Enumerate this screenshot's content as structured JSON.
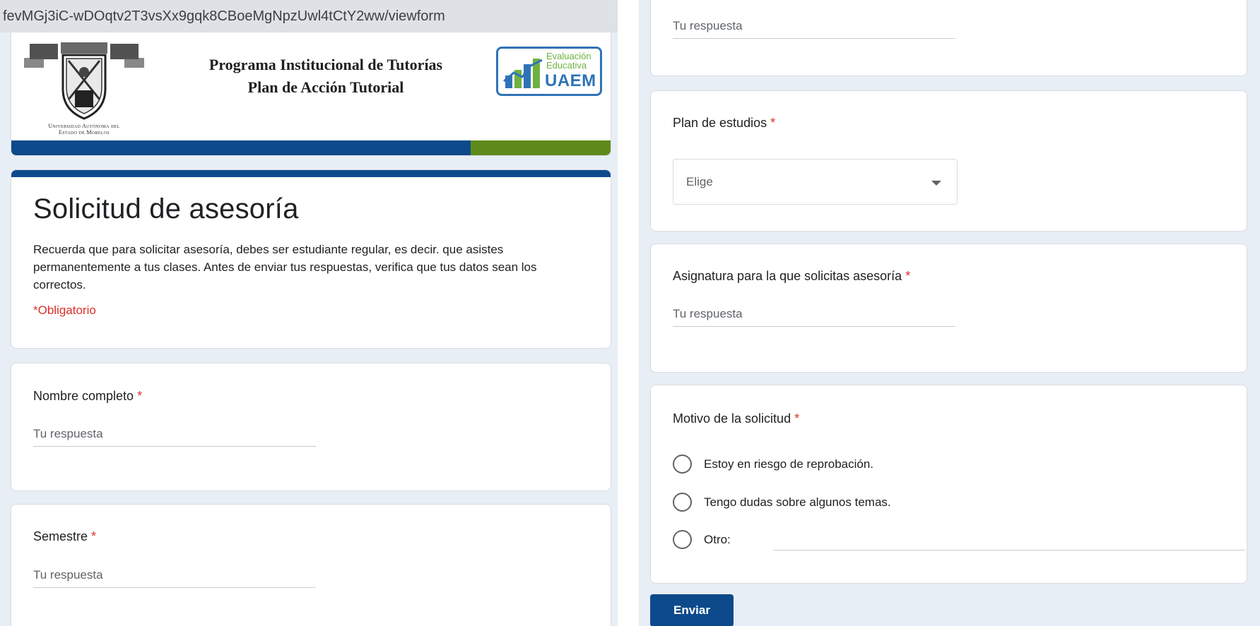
{
  "browser": {
    "url": "fevMGj3iC-wDOqtv2T3vsXx9gqk8CBoeMgNpzUwl4tCtY2ww/viewform"
  },
  "banner": {
    "crest_caption_line1": "Universidad Autónoma del",
    "crest_caption_line2": "Estado de Morelos",
    "title_line1": "Programa Institucional de Tutorías",
    "title_line2": "Plan de Acción Tutorial",
    "logo_line1": "Evaluación",
    "logo_line2": "Educativa",
    "logo_line3": "UAEM",
    "colors": {
      "blue": "#0d4a8b",
      "green": "#5f8a1b"
    }
  },
  "form": {
    "title": "Solicitud de asesoría",
    "description": "Recuerda que para solicitar asesoría, debes ser estudiante regular, es decir. que asistes permanentemente a tus clases. Antes de enviar tus respuestas, verifica que tus datos sean los correctos.",
    "required_note": "*Obligatorio",
    "required_mark": "*",
    "questions": {
      "nombre": {
        "label": "Nombre completo",
        "placeholder": "Tu respuesta"
      },
      "semestre": {
        "label": "Semestre",
        "placeholder": "Tu respuesta"
      },
      "previous_answer_placeholder": "Tu respuesta",
      "plan": {
        "label": "Plan de estudios",
        "select_value": "Elige"
      },
      "asignatura": {
        "label": "Asignatura para la que solicitas asesoría",
        "placeholder": "Tu respuesta"
      },
      "motivo": {
        "label": "Motivo de la solicitud",
        "options": [
          "Estoy en riesgo de reprobación.",
          "Tengo dudas sobre algunos temas.",
          "Otro:"
        ]
      }
    },
    "submit_label": "Enviar"
  }
}
